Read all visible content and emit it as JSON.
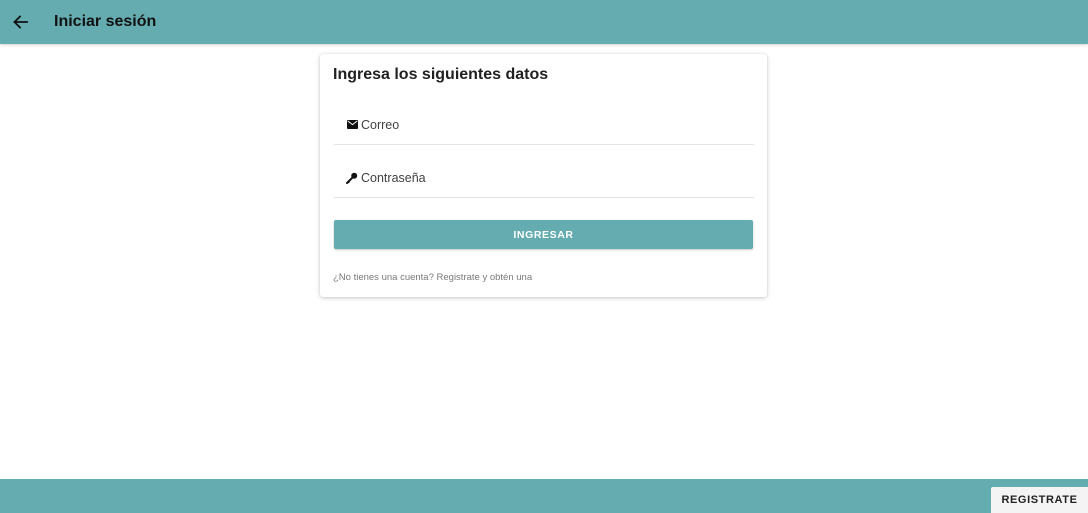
{
  "header": {
    "back_icon": "arrow-left-icon",
    "title": "Iniciar sesión"
  },
  "login_card": {
    "title": "Ingresa los siguientes datos",
    "email": {
      "icon": "envelope-icon",
      "placeholder": "Correo",
      "value": ""
    },
    "password": {
      "icon": "key-icon",
      "placeholder": "Contraseña",
      "value": ""
    },
    "submit_label": "INGRESAR",
    "signup_text": "¿No tienes una cuenta? Registrate y obtén una"
  },
  "footer": {
    "register_label": "REGISTRATE"
  },
  "colors": {
    "primary": "#64acb0",
    "background": "#ffffff",
    "text": "#212121"
  }
}
